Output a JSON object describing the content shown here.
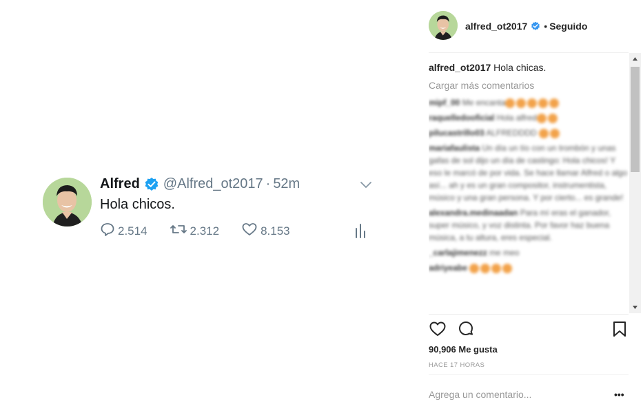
{
  "tweet": {
    "name": "Alfred",
    "handle": "@Alfred_ot2017",
    "separator": "·",
    "time": "52m",
    "text": "Hola chicos.",
    "replies": "2.514",
    "retweets": "2.312",
    "likes": "8.153",
    "icons": [
      "verified-badge-icon",
      "chevron-down-icon",
      "reply-icon",
      "retweet-icon",
      "heart-icon",
      "analytics-icon"
    ],
    "accent_color": "#1da1f2"
  },
  "post": {
    "username": "alfred_ot2017",
    "bullet": "•",
    "follow_status": "Seguido",
    "caption": {
      "user": "alfred_ot2017",
      "text": "Hola chicas."
    },
    "load_more": "Cargar más comentarios",
    "comments": [
      {
        "user": "mipf_00",
        "text": "Me encanta"
      },
      {
        "user": "raquelledooficial",
        "text": "Hola alfred"
      },
      {
        "user": "pilucastrillo03",
        "text": "ALFREDDDD"
      },
      {
        "user": "mariafaulista",
        "text": "Un día un tío con un trombón y unas gafas de sol dijo un día de castingo: Hola chicos! Y eso le marcó de por vida. Se hace llamar Alfred o algo así... ah y es un gran compositor, instrumentista, músico y una gran persona. Y por cierto... es grande!"
      },
      {
        "user": "alexandra.medinaadan",
        "text": "Para mí eras el ganador, super músico, y voz distinta. Por favor haz buena música, a tu altura, eres especial."
      },
      {
        "user": "_carlajimenezz",
        "text": "me meo"
      },
      {
        "user": "adriyeabe",
        "text": ""
      }
    ],
    "likes": "90,906 Me gusta",
    "time_ago": "HACE 17 HORAS",
    "comment_placeholder": "Agrega un comentario...",
    "more": "•••",
    "icons": [
      "heart-icon",
      "comment-icon",
      "bookmark-icon",
      "more-options-icon"
    ]
  }
}
